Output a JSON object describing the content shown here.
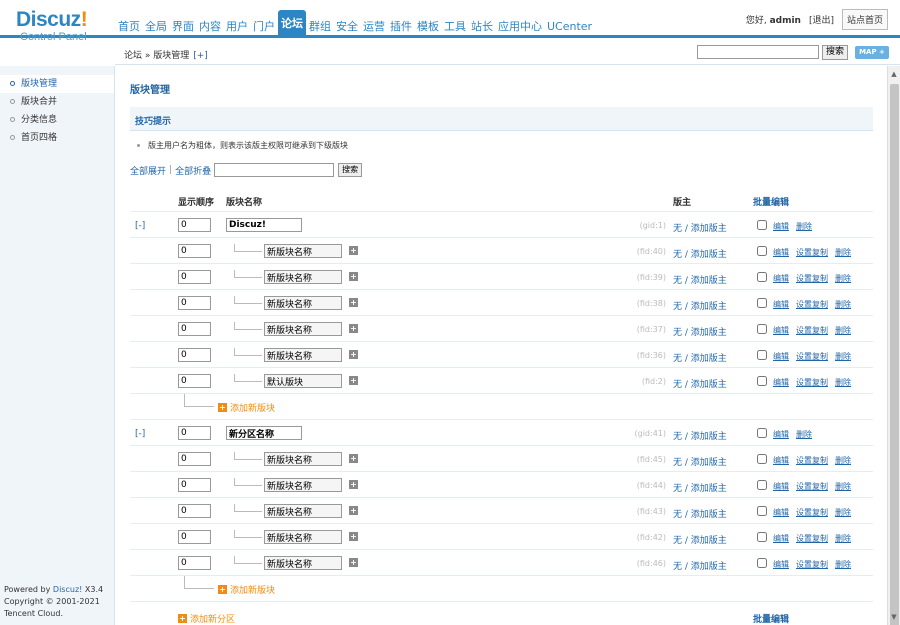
{
  "header": {
    "logo_text": "Discuz",
    "logo_bang": "!",
    "logo_sub": "Control Panel",
    "nav": [
      "首页",
      "全局",
      "界面",
      "内容",
      "用户",
      "门户",
      "论坛",
      "群组",
      "安全",
      "运营",
      "插件",
      "模板",
      "工具",
      "站长",
      "应用中心",
      "UCenter"
    ],
    "nav_active": "论坛",
    "welcome_prefix": "您好,",
    "username": "admin",
    "logout": "[退出]",
    "site_home": "站点首页"
  },
  "subbar": {
    "crumb": "论坛 » 版块管理",
    "crumb_add": "[+]",
    "search_button": "搜索",
    "map_button": "MAP +"
  },
  "sidebar": {
    "items": [
      "版块管理",
      "版块合并",
      "分类信息",
      "首页四格"
    ],
    "active": "版块管理"
  },
  "footer": {
    "powered_prefix": "Powered by ",
    "powered_brand": "Discuz!",
    "version": " X3.4",
    "copyright": "Copyright © 2001-2021",
    "company": "Tencent Cloud."
  },
  "main": {
    "title": "版块管理",
    "tip_title": "技巧提示",
    "tip_text": "版主用户名为粗体，则表示该版主权限可继承到下级版块",
    "expand_all": "全部展开",
    "collapse_all": "全部折叠",
    "search_button": "搜索",
    "col_order": "显示顺序",
    "col_name": "版块名称",
    "col_mods": "版主",
    "col_batch": "批量编辑",
    "op_edit": "编辑",
    "op_copy": "设置复制",
    "op_delete": "删除",
    "add_forum": "添加新版块",
    "add_category": "添加新分区",
    "batch_bottom": "批量编辑",
    "groups": [
      {
        "toggle": "[-]",
        "order": "0",
        "name": "Discuz!",
        "gid": "(gid:1)",
        "mods": "无 / 添加版主",
        "forums": [
          {
            "order": "0",
            "name": "新版块名称",
            "fid": "(fid:40)",
            "mods": "无 / 添加版主"
          },
          {
            "order": "0",
            "name": "新版块名称",
            "fid": "(fid:39)",
            "mods": "无 / 添加版主"
          },
          {
            "order": "0",
            "name": "新版块名称",
            "fid": "(fid:38)",
            "mods": "无 / 添加版主"
          },
          {
            "order": "0",
            "name": "新版块名称",
            "fid": "(fid:37)",
            "mods": "无 / 添加版主"
          },
          {
            "order": "0",
            "name": "新版块名称",
            "fid": "(fid:36)",
            "mods": "无 / 添加版主"
          },
          {
            "order": "0",
            "name": "默认版块",
            "fid": "(fid:2)",
            "mods": "无 / 添加版主"
          }
        ]
      },
      {
        "toggle": "[-]",
        "order": "0",
        "name": "新分区名称",
        "gid": "(gid:41)",
        "mods": "无 / 添加版主",
        "forums": [
          {
            "order": "0",
            "name": "新版块名称",
            "fid": "(fid:45)",
            "mods": "无 / 添加版主"
          },
          {
            "order": "0",
            "name": "新版块名称",
            "fid": "(fid:44)",
            "mods": "无 / 添加版主"
          },
          {
            "order": "0",
            "name": "新版块名称",
            "fid": "(fid:43)",
            "mods": "无 / 添加版主"
          },
          {
            "order": "0",
            "name": "新版块名称",
            "fid": "(fid:42)",
            "mods": "无 / 添加版主"
          },
          {
            "order": "0",
            "name": "新版块名称",
            "fid": "(fid:46)",
            "mods": "无 / 添加版主"
          }
        ]
      }
    ]
  }
}
